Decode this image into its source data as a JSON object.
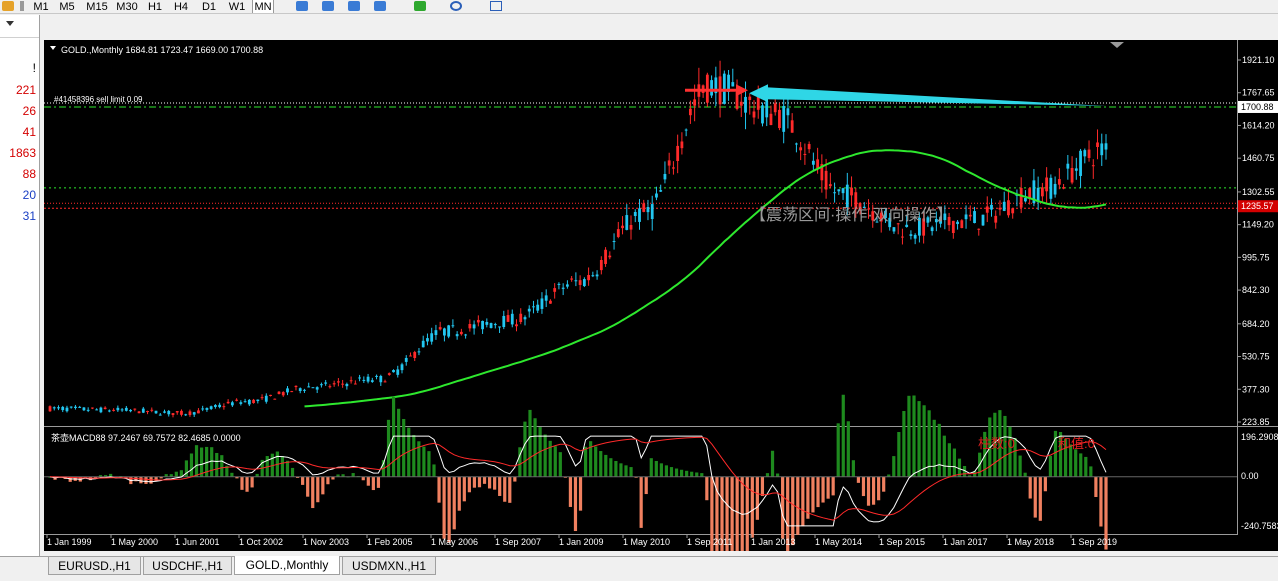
{
  "toolbar": {
    "timeframes": [
      "M1",
      "M5",
      "M15",
      "M30",
      "H1",
      "H4",
      "D1",
      "W1",
      "MN"
    ],
    "active_timeframe": "MN"
  },
  "left_panel": {
    "marker": "!",
    "values": [
      {
        "text": "221",
        "color": "#d40000"
      },
      {
        "text": "26",
        "color": "#d40000"
      },
      {
        "text": "41",
        "color": "#d40000"
      },
      {
        "text": "1863",
        "color": "#d40000"
      },
      {
        "text": "88",
        "color": "#d40000"
      },
      {
        "text": "20",
        "color": "#1a3fc4"
      },
      {
        "text": "31",
        "color": "#1a3fc4"
      }
    ]
  },
  "chart": {
    "header": "GOLD.,Monthly  1684.81 1723.47 1669.00 1700.88",
    "order_label": "#41458396 sell limit 0.09",
    "annotation": "【震荡区间·操作·双向操作】",
    "price_ticks": [
      "1921.10",
      "1767.65",
      "1614.20",
      "1460.75",
      "1302.55",
      "1149.20",
      "995.75",
      "842.30",
      "684.20",
      "530.75",
      "377.30",
      "223.85"
    ],
    "price_badges": [
      {
        "text": "1700.88",
        "bg": "#ffffff",
        "fg": "#000000"
      },
      {
        "text": "1235.57",
        "bg": "#d40000",
        "fg": "#ffffff"
      }
    ],
    "date_ticks": [
      "1 Jan 1999",
      "1 May 2000",
      "1 Jun 2001",
      "1 Oct 2002",
      "1 Nov 2003",
      "1 Feb 2005",
      "1 May 2006",
      "1 Sep 2007",
      "1 Jan 2009",
      "1 May 2010",
      "1 Sep 2011",
      "1 Jan 2013",
      "1 May 2014",
      "1 Sep 2015",
      "1 Jan 2017",
      "1 May 2018",
      "1 Sep 2019"
    ],
    "colors": {
      "bull": "#ff2a2a",
      "bear": "#22c6f0",
      "ma": "#2ee82e",
      "bg": "#000000"
    }
  },
  "macd": {
    "header": "茶壶MACD88 97.2467 69.7572 82.4685 0.0000",
    "label_count": "柱数:0",
    "label_sum": "和值:0",
    "ticks": [
      "196.2908",
      "0.00",
      "-240.7583"
    ]
  },
  "tabs": [
    "EURUSD.,H1",
    "USDCHF.,H1",
    "GOLD.,Monthly",
    "USDMXN.,H1"
  ],
  "active_tab": "GOLD.,Monthly",
  "chart_data": {
    "type": "line",
    "title": "GOLD.,Monthly",
    "x": [
      "1 Jan 1999",
      "1 May 2000",
      "1 Jun 2001",
      "1 Oct 2002",
      "1 Nov 2003",
      "1 Feb 2005",
      "1 May 2006",
      "1 Sep 2007",
      "1 Jan 2009",
      "1 May 2010",
      "1 Sep 2011",
      "1 Jan 2013",
      "1 May 2014",
      "1 Sep 2015",
      "1 Jan 2017",
      "1 May 2018",
      "1 Sep 2019"
    ],
    "series": [
      {
        "name": "GOLD.,Monthly",
        "values": [
          287,
          280,
          265,
          320,
          390,
          425,
          650,
          700,
          880,
          1200,
          1800,
          1670,
          1290,
          1130,
          1170,
          1310,
          1500
        ]
      }
    ],
    "ylim": [
      223.85,
      1921.1
    ]
  }
}
